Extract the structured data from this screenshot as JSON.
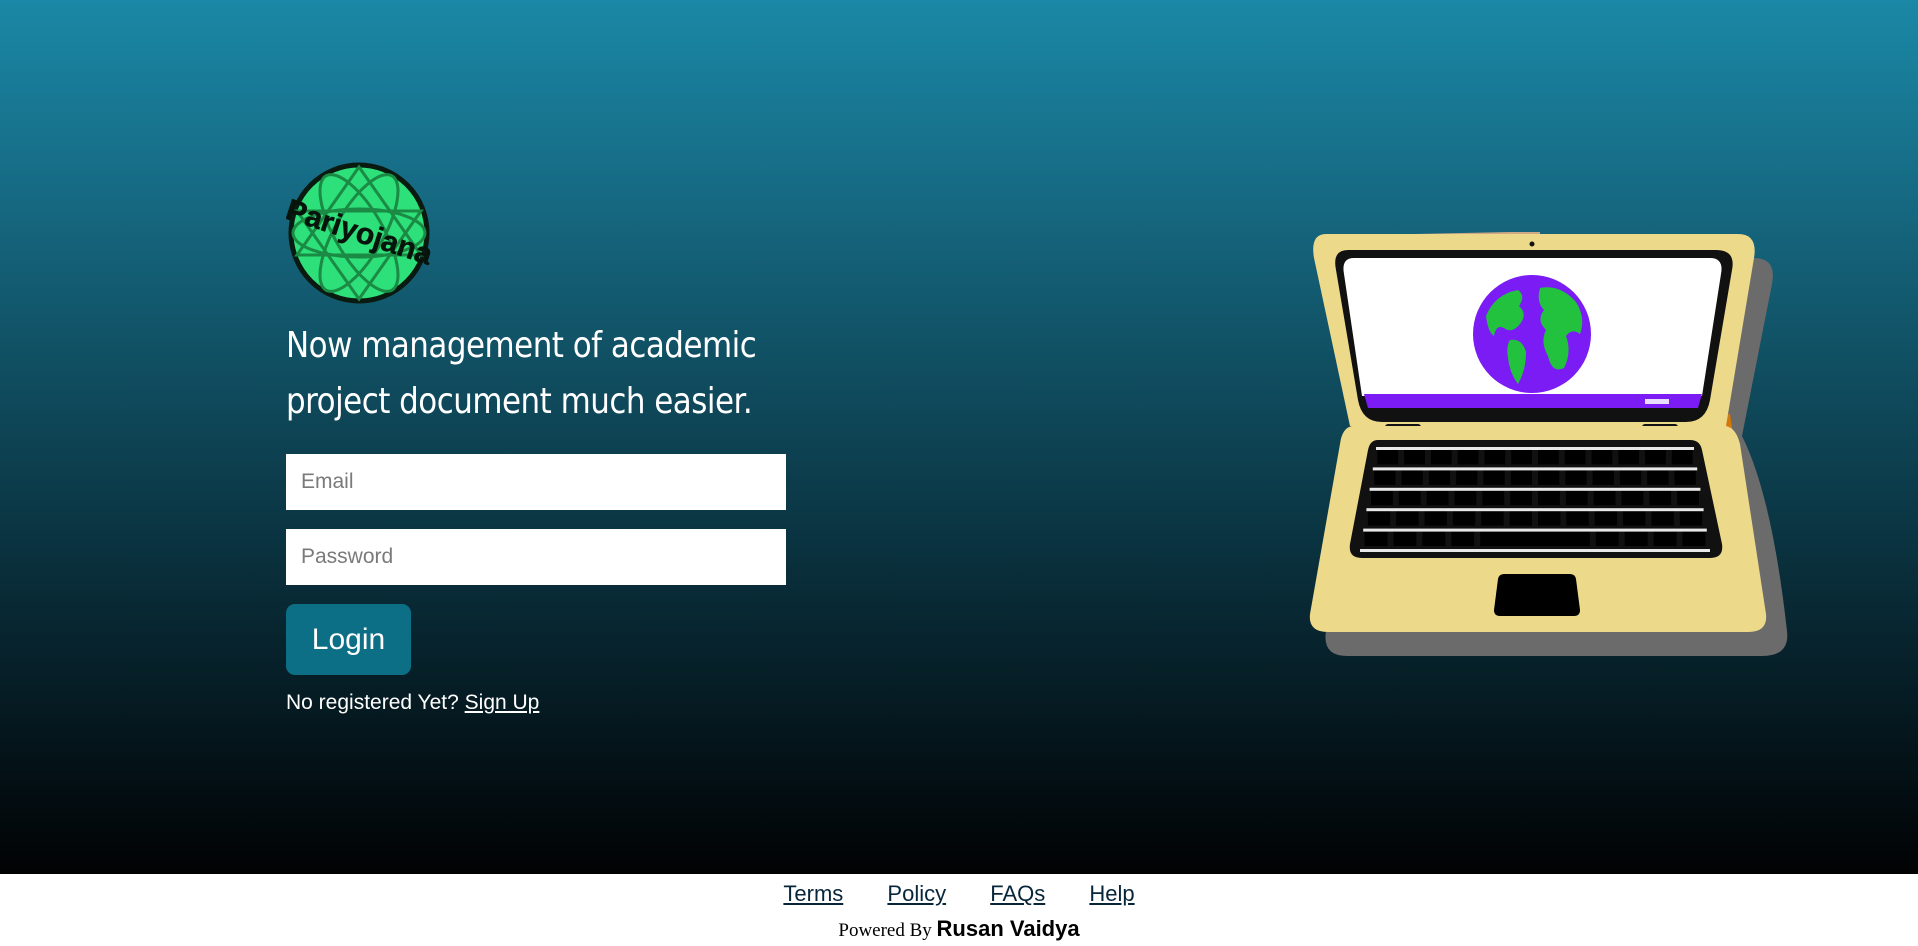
{
  "brand": {
    "logo_text": "Pariyojana",
    "logo_color": "#2ee07a"
  },
  "hero": {
    "tagline": "Now management of academic project document much easier.",
    "gradient_top": "#1a88a6",
    "gradient_bottom": "#010203"
  },
  "login_form": {
    "email_placeholder": "Email",
    "password_placeholder": "Password",
    "login_label": "Login",
    "button_color": "#0c6f86",
    "signup_prompt": "No registered Yet?",
    "signup_link": "Sign Up"
  },
  "illustration": {
    "name": "laptop-globe-icon",
    "body_color": "#ecd98a",
    "globe_ocean": "#7b1cf5",
    "globe_land": "#22c23f"
  },
  "footer": {
    "links": [
      "Terms",
      "Policy",
      "FAQs",
      "Help"
    ],
    "powered_prefix": "Powered By",
    "author": "Rusan Vaidya"
  }
}
